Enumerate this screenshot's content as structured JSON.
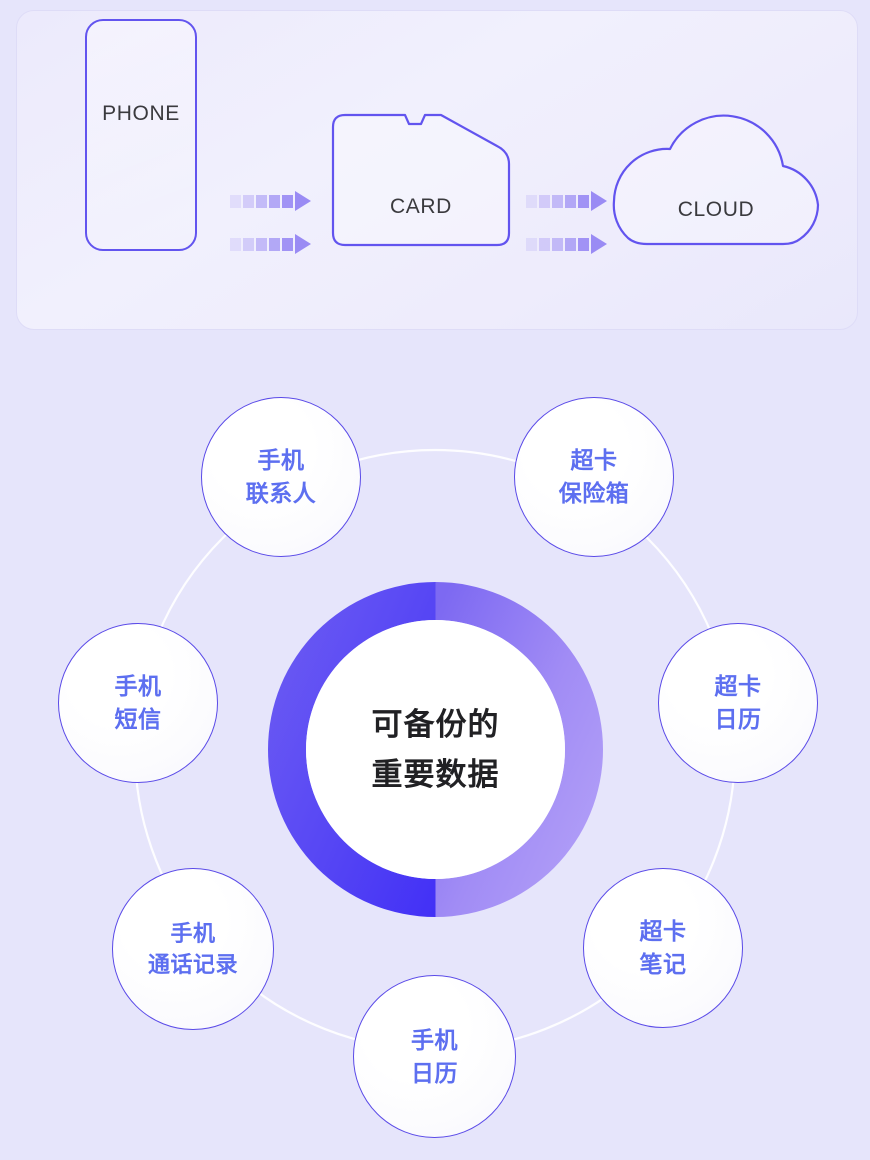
{
  "top_panel": {
    "shapes": [
      {
        "id": "phone",
        "icon": "phone-outline-icon",
        "label": "PHONE"
      },
      {
        "id": "card",
        "icon": "memory-card-outline-icon",
        "label": "CARD"
      },
      {
        "id": "cloud",
        "icon": "cloud-outline-icon",
        "label": "CLOUD"
      }
    ],
    "arrows": [
      {
        "id": "phone-to-card-top",
        "icon": "dashed-arrow-right-icon"
      },
      {
        "id": "phone-to-card-bottom",
        "icon": "dashed-arrow-right-icon"
      },
      {
        "id": "card-to-cloud-top",
        "icon": "dashed-arrow-right-icon"
      },
      {
        "id": "card-to-cloud-bottom",
        "icon": "dashed-arrow-right-icon"
      }
    ]
  },
  "center": {
    "title_line1": "可备份的",
    "title_line2": "重要数据"
  },
  "nodes": [
    {
      "id": "phone-contacts",
      "line1": "手机",
      "line2": "联系人"
    },
    {
      "id": "card-safe",
      "line1": "超卡",
      "line2": "保险箱"
    },
    {
      "id": "card-calendar",
      "line1": "超卡",
      "line2": "日历"
    },
    {
      "id": "card-notes",
      "line1": "超卡",
      "line2": "笔记"
    },
    {
      "id": "phone-calendar",
      "line1": "手机",
      "line2": "日历"
    },
    {
      "id": "phone-calllog",
      "line1": "手机",
      "line2": "通话记录"
    },
    {
      "id": "phone-sms",
      "line1": "手机",
      "line2": "短信"
    }
  ],
  "colors": {
    "background": "#e6e5fb",
    "panel_background": "#efedfc",
    "outline_purple": "#6254ef",
    "node_text": "#5d6ff0",
    "donut_dark": "#4433f5",
    "donut_light": "#a992f5",
    "center_text": "#212124",
    "shape_label": "#3a3a3e"
  }
}
